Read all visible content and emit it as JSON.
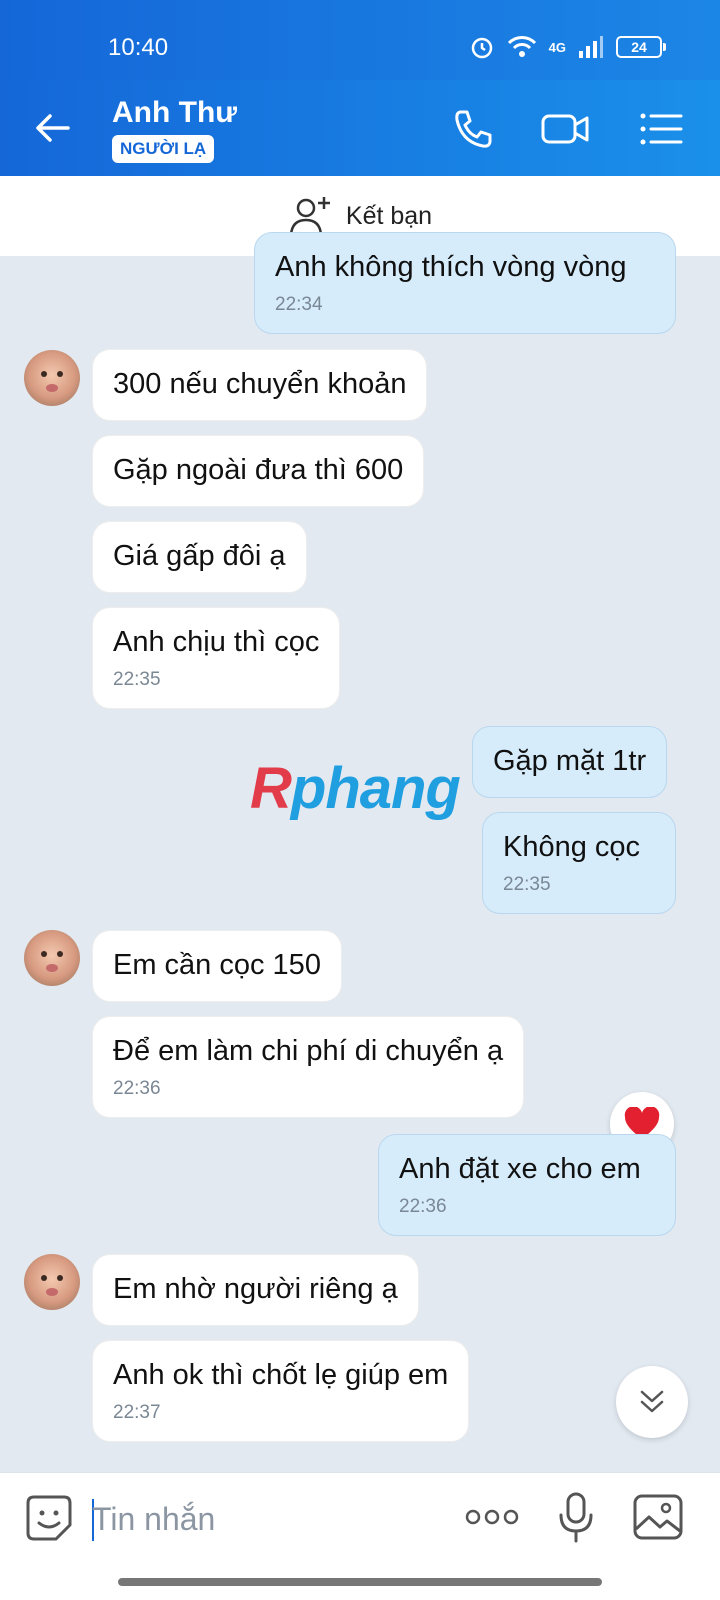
{
  "status_bar": {
    "time": "10:40",
    "network": "4G",
    "battery": "24"
  },
  "header": {
    "contact_name": "Anh Thư",
    "stranger_badge": "NGƯỜI LẠ"
  },
  "add_friend": {
    "label": "Kết bạn"
  },
  "messages": [
    {
      "text": "Anh không thích vòng vòng",
      "time": "22:34"
    },
    {
      "text": "300 nếu chuyển khoản"
    },
    {
      "text": "Gặp ngoài đưa thì 600"
    },
    {
      "text": "Giá gấp đôi ạ"
    },
    {
      "text": "Anh chịu thì cọc",
      "time": "22:35"
    },
    {
      "text": "Gặp mặt 1tr"
    },
    {
      "text": "Không cọc",
      "time": "22:35"
    },
    {
      "text": "Em cần cọc 150"
    },
    {
      "text": "Để em làm chi phí di chuyển ạ",
      "time": "22:36"
    },
    {
      "text": "Anh đặt xe cho em",
      "time": "22:36"
    },
    {
      "text": "Em nhờ người riêng ạ"
    },
    {
      "text": "Anh ok thì chốt lẹ giúp em",
      "time": "22:37"
    }
  ],
  "watermark": {
    "first": "R",
    "rest": "phang"
  },
  "input": {
    "placeholder": "Tin nhắn"
  },
  "colors": {
    "header": "#1567d8",
    "outgoing_bubble": "#d6ecfb",
    "background": "#e2e9f1"
  }
}
